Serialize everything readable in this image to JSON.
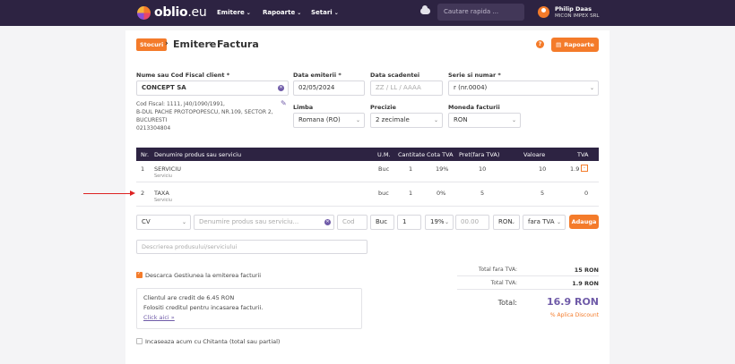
{
  "topbar": {
    "logo_main": "oblio",
    "logo_suffix": ".eu",
    "nav": [
      {
        "label": "Emitere"
      },
      {
        "label": "Rapoarte"
      },
      {
        "label": "Setari"
      }
    ],
    "search_placeholder": "Cautare rapida ...",
    "user_name": "Philip Daas",
    "user_company": "MICON IMPEX SRL",
    "colors": {
      "bar": "#2d2342",
      "accent": "#f47b2a",
      "purple": "#6f5ba8"
    }
  },
  "breadcrumb": {
    "badge": "Stocuri",
    "items": [
      "Emitere",
      "Factura"
    ]
  },
  "header": {
    "help_icon": "question-icon",
    "reports_button": "Rapoarte"
  },
  "form": {
    "client_label": "Nume sau Cod Fiscal client *",
    "client_value": "CONCEPT SA",
    "client_info": [
      "Cod Fiscal: 1111, J40/1090/1991,",
      "B-DUL PACHE PROTOPOPESCU, NR.109, SECTOR 2,",
      "BUCURESTI",
      "0213304804"
    ],
    "issue_date_label": "Data emiterii *",
    "issue_date_value": "02/05/2024",
    "due_date_label": "Data scadentei",
    "due_date_placeholder": "ZZ / LL / AAAA",
    "series_label": "Serie si numar *",
    "series_value": "r (nr.0004)",
    "language_label": "Limba",
    "language_value": "Romana (RO)",
    "precision_label": "Precizie",
    "precision_value": "2 zecimale",
    "currency_label": "Moneda facturii",
    "currency_value": "RON"
  },
  "table": {
    "headers": [
      "Nr.",
      "Denumire produs sau serviciu",
      "U.M.",
      "Cantitate",
      "Cota TVA",
      "Pret(fara TVA)",
      "Valoare",
      "TVA"
    ],
    "rows": [
      {
        "nr": "1",
        "name": "SERVICIU",
        "type": "Serviciu",
        "um": "Buc",
        "qty": "1",
        "vat_rate": "19%",
        "price": "10",
        "value": "10",
        "vat": "1.9"
      },
      {
        "nr": "2",
        "name": "TAXA",
        "type": "Serviciu",
        "um": "buc",
        "qty": "1",
        "vat_rate": "0%",
        "price": "5",
        "value": "5",
        "vat": "0"
      }
    ]
  },
  "add_row": {
    "code_type": "CV",
    "product_placeholder": "Denumire produs sau serviciu...",
    "code_placeholder": "Cod",
    "unit": "Buc",
    "quantity": "1",
    "vat_rate": "19%",
    "price_placeholder": "00.00",
    "currency": "RON",
    "vat_mode": "fara TVA",
    "add_button": "Adauga",
    "description_placeholder": "Descrierea produsului/serviciului"
  },
  "options": {
    "stock_discharge": "Descarca Gestiunea la emiterea facturii",
    "credit_text": "Clientul are credit de 6.45 RON",
    "credit_use": "Folositi creditul pentru incasarea facturii.",
    "credit_link": "Click aici »",
    "collect_now": "Incaseaza acum cu Chitanta (total sau partial)"
  },
  "totals": {
    "net_label": "Total fara TVA:",
    "net_value": "15 RON",
    "vat_label": "Total TVA:",
    "vat_value": "1.9 RON",
    "total_label": "Total:",
    "total_value": "16.9 RON",
    "discount_link": "% Aplica Discount"
  }
}
